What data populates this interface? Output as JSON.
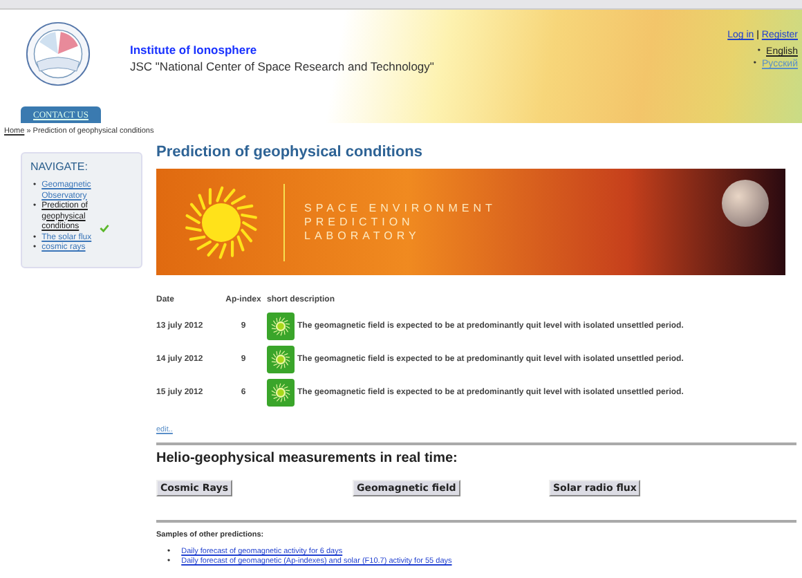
{
  "header": {
    "institute": "Institute of Ionosphere",
    "organization": "JSC \"National Center of Space Research and Technology\"",
    "login": "Log in",
    "separator": "|",
    "register": "Register",
    "languages": [
      {
        "marker": "•",
        "label": "English",
        "selected": true
      },
      {
        "marker": "•",
        "label": "Русский",
        "selected": false
      }
    ],
    "contact_tab": "CONTACT US"
  },
  "breadcrumb": {
    "home": "Home",
    "separator": "»",
    "current": "Prediction of geophysical conditions"
  },
  "sidebar": {
    "title": "NAVIGATE:",
    "items": [
      {
        "marker": "•",
        "label": "Geomagnetic Observatory",
        "selected": false
      },
      {
        "marker": "•",
        "label": "Prediction of geophysical conditions",
        "selected": true
      },
      {
        "marker": "•",
        "label": "The solar flux",
        "selected": false
      },
      {
        "marker": "•",
        "label": "cosmic rays",
        "selected": false
      }
    ]
  },
  "page_title": "Prediction of geophysical conditions",
  "banner": {
    "lines": [
      "SPACE ENVIRONMENT",
      "PREDICTION",
      "LABORATORY"
    ]
  },
  "table": {
    "columns": [
      "Date",
      "Ap-index",
      "short description"
    ],
    "rows": [
      {
        "date": "13 july 2012",
        "ap_index": "9",
        "description": "The geomagnetic field is expected to be at predominantly quit level with isolated unsettled period."
      },
      {
        "date": "14 july 2012",
        "ap_index": "9",
        "description": "The geomagnetic field is expected to be at predominantly quit level with isolated unsettled period."
      },
      {
        "date": "15 july 2012",
        "ap_index": "6",
        "description": "The geomagnetic field is expected to be at predominantly quit level with isolated unsettled period."
      }
    ]
  },
  "edit_link": "edit..",
  "realtime": {
    "heading": "Helio-geophysical measurements in real time:",
    "buttons": [
      "Cosmic Rays",
      "Geomagnetic field",
      "Solar radio flux"
    ]
  },
  "samples": {
    "heading": "Samples of other predictions:",
    "links": [
      {
        "marker": "•",
        "label": "Daily forecast of geomagnetic activity for 6 days"
      },
      {
        "marker": "•",
        "label": "Daily forecast of geomagnetic (Ap-indexes) and solar (F10.7) activity for 55 days"
      }
    ]
  }
}
